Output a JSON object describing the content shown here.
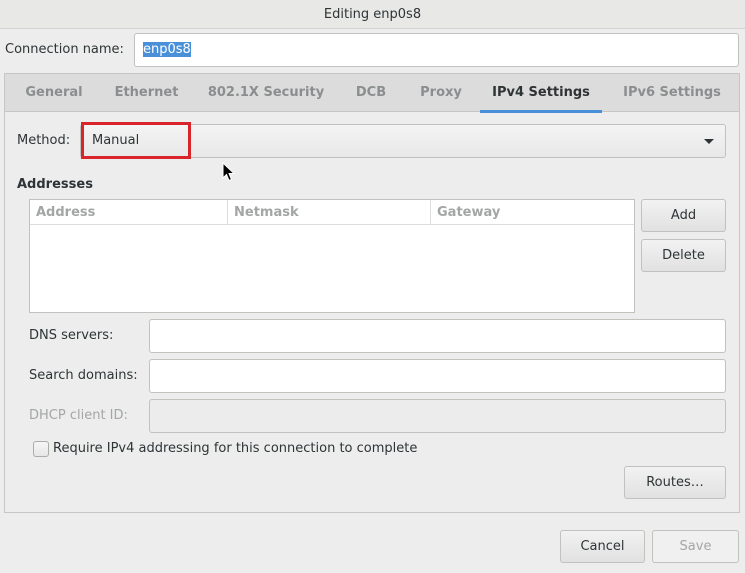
{
  "window": {
    "title": "Editing enp0s8"
  },
  "connection": {
    "label": "Connection name:",
    "value": "enp0s8"
  },
  "tabs": [
    {
      "label": "General",
      "active": false
    },
    {
      "label": "Ethernet",
      "active": false
    },
    {
      "label": "802.1X Security",
      "active": false
    },
    {
      "label": "DCB",
      "active": false
    },
    {
      "label": "Proxy",
      "active": false
    },
    {
      "label": "IPv4 Settings",
      "active": true
    },
    {
      "label": "IPv6 Settings",
      "active": false
    }
  ],
  "ipv4": {
    "method_label": "Method:",
    "method_value": "Manual",
    "addresses_title": "Addresses",
    "columns": [
      "Address",
      "Netmask",
      "Gateway"
    ],
    "rows": [],
    "add_label": "Add",
    "delete_label": "Delete",
    "dns_label": "DNS servers:",
    "dns_value": "",
    "search_label": "Search domains:",
    "search_value": "",
    "dhcp_label": "DHCP client ID:",
    "dhcp_value": "",
    "require_label": "Require IPv4 addressing for this connection to complete",
    "require_checked": false,
    "routes_label": "Routes…"
  },
  "footer": {
    "cancel_label": "Cancel",
    "save_label": "Save"
  },
  "colors": {
    "accent": "#4a90d9",
    "highlight_box": "#d9242b"
  }
}
